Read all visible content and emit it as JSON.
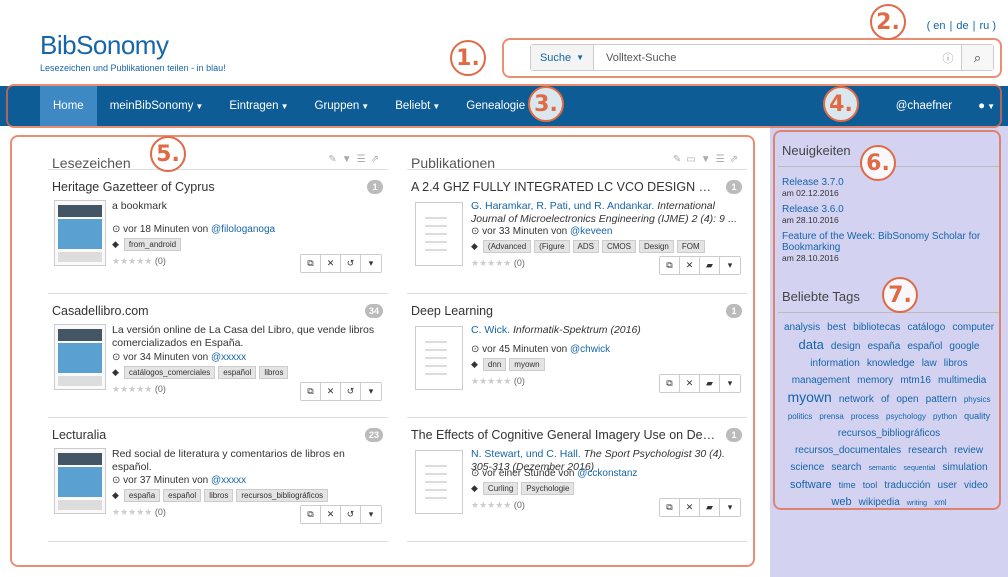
{
  "header": {
    "logo": "BibSonomy",
    "tagline": "Lesezeichen und Publikationen teilen - in blau!",
    "lang": [
      "( en",
      "|",
      "de",
      "|",
      "ru )"
    ]
  },
  "search": {
    "selector": "Suche",
    "placeholder": "Volltext-Suche"
  },
  "nav": {
    "items": [
      "Home",
      "meinBibSonomy",
      "Eintragen",
      "Gruppen",
      "Beliebt",
      "Genealogie"
    ],
    "user": "@chaefner"
  },
  "bookmarks": {
    "title": "Lesezeichen",
    "posts": [
      {
        "title": "Heritage Gazetteer of Cyprus",
        "count": "1",
        "desc": "a bookmark",
        "meta_prefix": "vor 18 Minuten von",
        "user": "@filologanoga",
        "tags": [
          "from_android"
        ],
        "rating": "(0)"
      },
      {
        "title": "Casadellibro.com",
        "count": "34",
        "desc": "La versión online de La Casa del Libro, que vende libros comercializados en España.",
        "meta_prefix": "vor 34 Minuten von",
        "user": "@xxxxx",
        "tags": [
          "catálogos_comerciales",
          "español",
          "libros"
        ],
        "rating": "(0)"
      },
      {
        "title": "Lecturalia",
        "count": "23",
        "desc": "Red social de literatura y comentarios de libros en español.",
        "meta_prefix": "vor 37 Minuten von",
        "user": "@xxxxx",
        "tags": [
          "españa",
          "español",
          "libros",
          "recursos_bibliográficos"
        ],
        "rating": "(0)"
      }
    ]
  },
  "publications": {
    "title": "Publikationen",
    "posts": [
      {
        "title": "A 2.4 GHZ FULLY INTEGRATED LC VCO DESIGN U...",
        "count": "1",
        "authors": "G. Haramkar, R. Pati, und R. Andankar.",
        "journal": "International Journal of Microelectronics Engineering (IJME) 2 (4): 9",
        "more": "...",
        "meta_prefix": "vor 33 Minuten von",
        "user": "@keveen",
        "tags": [
          "(Advanced",
          "(Figure",
          "ADS",
          "CMOS",
          "Design",
          "FOM"
        ],
        "rating": "(0)"
      },
      {
        "title": "Deep Learning",
        "count": "1",
        "authors": "C. Wick.",
        "journal": "Informatik-Spektrum (2016)",
        "more": "",
        "meta_prefix": "vor 45 Minuten von",
        "user": "@chwick",
        "tags": [
          "dnn",
          "myown"
        ],
        "rating": "(0)"
      },
      {
        "title": "The Effects of Cognitive General Imagery Use on Deci...",
        "count": "1",
        "authors": "N. Stewart, und C. Hall.",
        "journal": "The Sport Psychologist 30 (4). 305-313 (Dezember 2016)",
        "more": "",
        "meta_prefix": "vor einer Stunde von",
        "user": "@cckonstanz",
        "tags": [
          "Curling",
          "Psychologie"
        ],
        "rating": "(0)"
      }
    ]
  },
  "news": {
    "title": "Neuigkeiten",
    "items": [
      {
        "label": "Release 3.7.0",
        "date": "am 02.12.2016"
      },
      {
        "label": "Release 3.6.0",
        "date": "am 28.10.2016"
      },
      {
        "label": "Feature of the Week: BibSonomy Scholar for Bookmarking",
        "date": "am 28.10.2016"
      }
    ]
  },
  "tags": {
    "title": "Beliebte Tags",
    "cloud": [
      [
        "analysis",
        10
      ],
      [
        "best",
        10
      ],
      [
        "bibliotecas",
        10
      ],
      [
        "catálogo",
        10
      ],
      [
        "computer",
        10
      ],
      [
        "data",
        13
      ],
      [
        "design",
        10
      ],
      [
        "españa",
        10
      ],
      [
        "español",
        10
      ],
      [
        "google",
        10
      ],
      [
        "information",
        10
      ],
      [
        "knowledge",
        10
      ],
      [
        "law",
        10
      ],
      [
        "libros",
        10
      ],
      [
        "management",
        10
      ],
      [
        "memory",
        10
      ],
      [
        "mtm16",
        10
      ],
      [
        "multimedia",
        10
      ],
      [
        "myown",
        14
      ],
      [
        "network",
        10
      ],
      [
        "of",
        10
      ],
      [
        "open",
        10
      ],
      [
        "pattern",
        10
      ],
      [
        "physics",
        8
      ],
      [
        "politics",
        8
      ],
      [
        "prensa",
        8
      ],
      [
        "process",
        8
      ],
      [
        "psychology",
        8
      ],
      [
        "python",
        8
      ],
      [
        "quality",
        9
      ],
      [
        "recursos_bibliográficos",
        10
      ],
      [
        "recursos_documentales",
        10
      ],
      [
        "research",
        10
      ],
      [
        "review",
        10
      ],
      [
        "science",
        10
      ],
      [
        "search",
        10
      ],
      [
        "semantic",
        7
      ],
      [
        "sequential",
        7
      ],
      [
        "simulation",
        10
      ],
      [
        "software",
        11
      ],
      [
        "time",
        9
      ],
      [
        "tool",
        9
      ],
      [
        "traducción",
        10
      ],
      [
        "user",
        10
      ],
      [
        "video",
        10
      ],
      [
        "web",
        11
      ],
      [
        "wikipedia",
        10
      ],
      [
        "writing",
        7
      ],
      [
        "xml",
        8
      ]
    ]
  },
  "annotations": [
    "1.",
    "2.",
    "3.",
    "4.",
    "5.",
    "6.",
    "7."
  ],
  "colors": {
    "brand": "#1565a8",
    "nav": "#0e5c96",
    "nav_active": "#3e88c4",
    "sidebar": "#d4d2f1",
    "annotation": "#e06a44"
  }
}
